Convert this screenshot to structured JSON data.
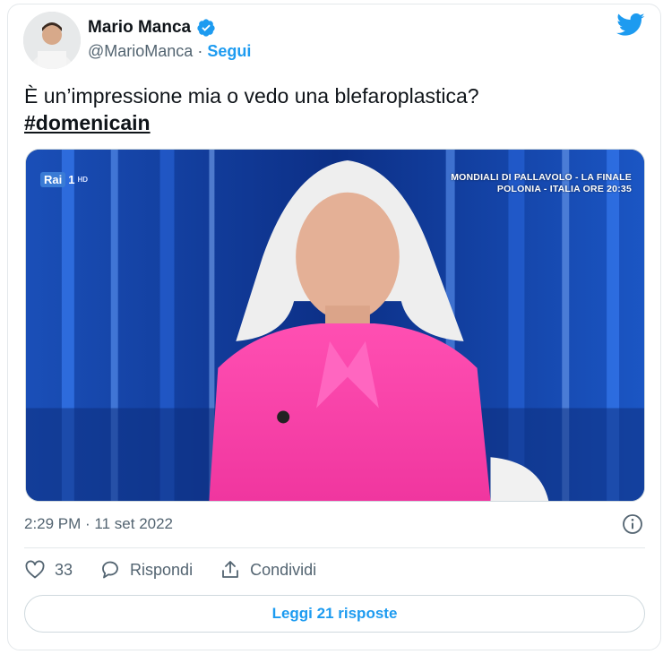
{
  "author": {
    "name": "Mario Manca",
    "handle": "@MarioManca",
    "separator": "·",
    "follow_label": "Segui",
    "verified_icon": "verified-badge-icon"
  },
  "tweet": {
    "text": "È un’impressione mia o vedo una blefaroplastica?",
    "hashtag": "#domenicain"
  },
  "media": {
    "channel_logo": "Rai",
    "channel_number": "1",
    "channel_hd": "HD",
    "overlay_line1": "MONDIALI DI PALLAVOLO - LA FINALE",
    "overlay_line2": "POLONIA - ITALIA ORE 20:35"
  },
  "meta": {
    "timestamp": "2:29 PM · 11 set 2022"
  },
  "actions": {
    "like_count": "33",
    "reply_label": "Rispondi",
    "share_label": "Condividi"
  },
  "read_replies_label": "Leggi 21 risposte",
  "colors": {
    "accent": "#1d9bf0",
    "text": "#0f1419",
    "secondary": "#536471"
  }
}
